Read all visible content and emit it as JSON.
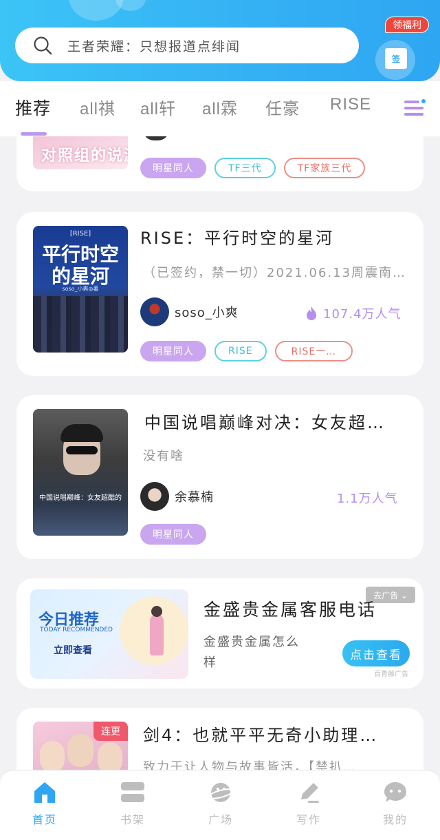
{
  "search": {
    "placeholder": "王者荣耀：只想报道点绯闻"
  },
  "gift_badge": "领福利",
  "gift_box_label": "签",
  "tabs": [
    {
      "label": "推荐",
      "active": true
    },
    {
      "label": "all祺",
      "active": false
    },
    {
      "label": "all轩",
      "active": false
    },
    {
      "label": "all霖",
      "active": false
    },
    {
      "label": "任豪",
      "active": false
    },
    {
      "label": "RISE",
      "active": false
    }
  ],
  "cards": [
    {
      "tags": [
        "明星同人",
        "TF三代",
        "TF家族三代"
      ],
      "cover_text": "对照组的说漏"
    },
    {
      "title": "RISE：平行时空的星河",
      "description": "（已签约，禁一切）2021.06.13周震南…",
      "author": "soso_小爽",
      "popularity": "107.4万人气",
      "tags": [
        "明星同人",
        "RISE",
        "RISE一…"
      ],
      "cover_label": "[RISE]",
      "cover_title_1": "平行时空",
      "cover_title_2": "的星河",
      "cover_author": "soso_小爽◎著"
    },
    {
      "title": "中国说唱巅峰对决：女友超…",
      "description": "没有啥",
      "author": "余慕楠",
      "popularity": "1.1万人气",
      "tags": [
        "明星同人"
      ],
      "cover_caption": "中国说唱巅峰：女友超酷的"
    },
    {
      "title": "剑4：也就平平无奇小助理…",
      "description": "致力于让人物与故事皆活，【禁扒…",
      "badge": "连更"
    }
  ],
  "ad": {
    "title": "金盛贵金属客服电话",
    "description_line1": "金盛贵金属怎么",
    "description_line2": "样",
    "button": "点击查看",
    "badge": "去广告 ⌄",
    "source": "百青藤广告",
    "image_title": "今日推荐",
    "image_subtitle": "TODAY RECOMMENDED",
    "image_button": "立即查看"
  },
  "nav": [
    {
      "label": "首页",
      "icon": "home-icon",
      "active": true
    },
    {
      "label": "书架",
      "icon": "bookshelf-icon",
      "active": false
    },
    {
      "label": "广场",
      "icon": "planet-icon",
      "active": false
    },
    {
      "label": "写作",
      "icon": "pen-icon",
      "active": false
    },
    {
      "label": "我的",
      "icon": "profile-chat-icon",
      "active": false
    }
  ],
  "colors": {
    "accent": "#2ea6f2",
    "tab_indicator": "#b79af0",
    "tag_purple": "#c9a6ef"
  }
}
